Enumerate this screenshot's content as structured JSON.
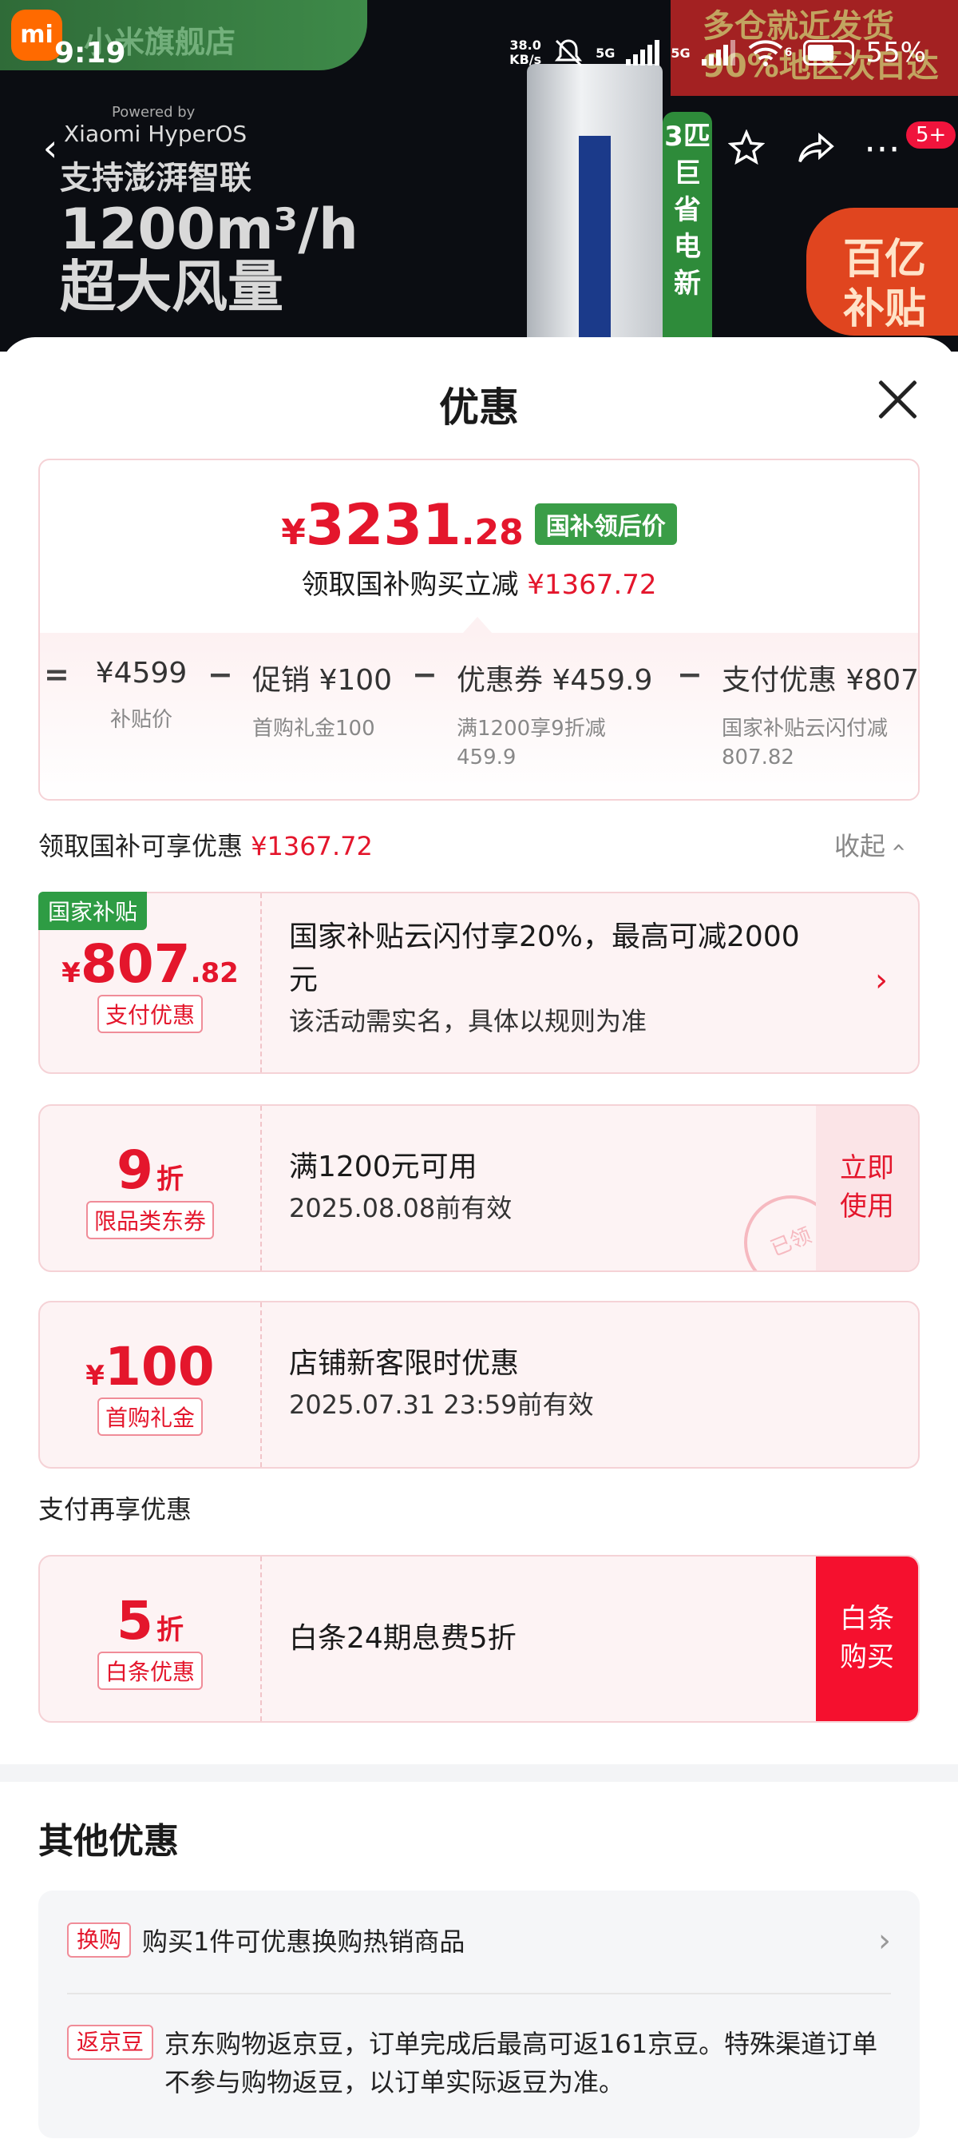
{
  "status": {
    "time": "9:19",
    "speed": "38.0",
    "speed_unit": "KB/s",
    "net1": "5G",
    "net2": "5G",
    "wifi_level": "6",
    "battery": "55%"
  },
  "header": {
    "store": "小米旗舰店",
    "badge": "5+",
    "brand": "Xiaomi HyperOS",
    "brand_sup": "Powered by",
    "promo": "多仓就近发货 90%地区次日达",
    "hero1": "支持澎湃智联",
    "hero2": "1200m³/h",
    "hero3": "超大风量",
    "vertical": "3匹巨省电新",
    "subsidy": "百亿补贴"
  },
  "sheet": {
    "title": "优惠",
    "price": {
      "currency": "¥",
      "int": "3231",
      "dec": ".28",
      "tag": "国补领后价",
      "desc": "领取国补购买立减",
      "saving": "¥1367.72"
    },
    "breakdown": [
      {
        "value": "¥4599",
        "desc": "补贴价"
      },
      {
        "value": "促销 ¥100",
        "desc": "首购礼金100"
      },
      {
        "value": "优惠券 ¥459.9",
        "desc": "满1200享9折减\n459.9"
      },
      {
        "value": "支付优惠 ¥807",
        "desc": "国家补贴云闪付减\n807.82"
      }
    ],
    "ops": [
      "=",
      "−",
      "−",
      "−"
    ],
    "section1": {
      "label": "领取国补可享优惠",
      "amount": "¥1367.72",
      "collapse": "收起"
    },
    "coupons": [
      {
        "flag": "国家补贴",
        "cur": "¥",
        "big": "807",
        "small": ".82",
        "tag": "支付优惠",
        "title": "国家补贴云闪付享20%，最高可减2000元",
        "sub": "该活动需实名，具体以规则为准"
      },
      {
        "big": "9",
        "zhe": "折",
        "tag": "限品类东券",
        "title": "满1200元可用",
        "sub": "2025.08.08前有效",
        "action": "立即\n使用",
        "stamp": "已领"
      },
      {
        "cur": "¥",
        "big": "100",
        "tag": "首购礼金",
        "title": "店铺新客限时优惠",
        "sub": "2025.07.31 23:59前有效"
      }
    ],
    "section2": {
      "label": "支付再享优惠"
    },
    "pay": {
      "big": "5",
      "zhe": "折",
      "tag": "白条优惠",
      "title": "白条24期息费5折",
      "action": "白条\n购买"
    },
    "other": {
      "title": "其他优惠",
      "items": [
        {
          "tag": "换购",
          "text": "购买1件可优惠换购热销商品"
        },
        {
          "tag": "返京豆",
          "text": "京东购物返京豆，订单完成后最高可返161京豆。特殊渠道订单不参与购物返豆，以订单实际返豆为准。"
        }
      ]
    }
  }
}
